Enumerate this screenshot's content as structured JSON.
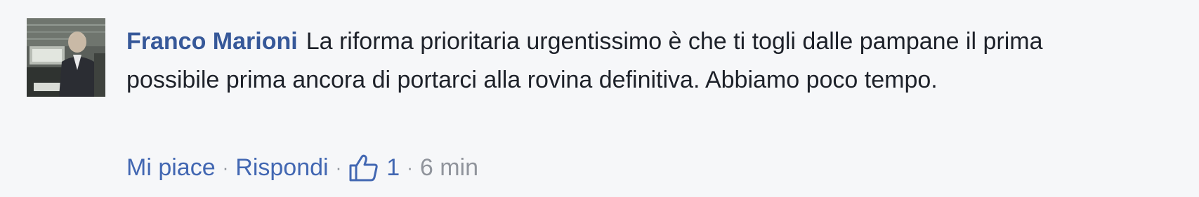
{
  "comment": {
    "author": "Franco Marioni",
    "text": "La riforma prioritaria urgentissimo è che ti togli dalle pampane il prima possibile prima ancora di portarci alla rovina definitiva. Abbiamo poco tempo.",
    "actions": {
      "like_label": "Mi piace",
      "reply_label": "Rispondi",
      "separator": "·",
      "like_count": "1",
      "like_icon": "thumbs-up-icon",
      "timestamp": "6 min"
    }
  },
  "colors": {
    "background": "#f6f7f9",
    "author_link": "#365899",
    "action_link": "#4267b2",
    "text": "#1d2129",
    "muted": "#90949c"
  }
}
